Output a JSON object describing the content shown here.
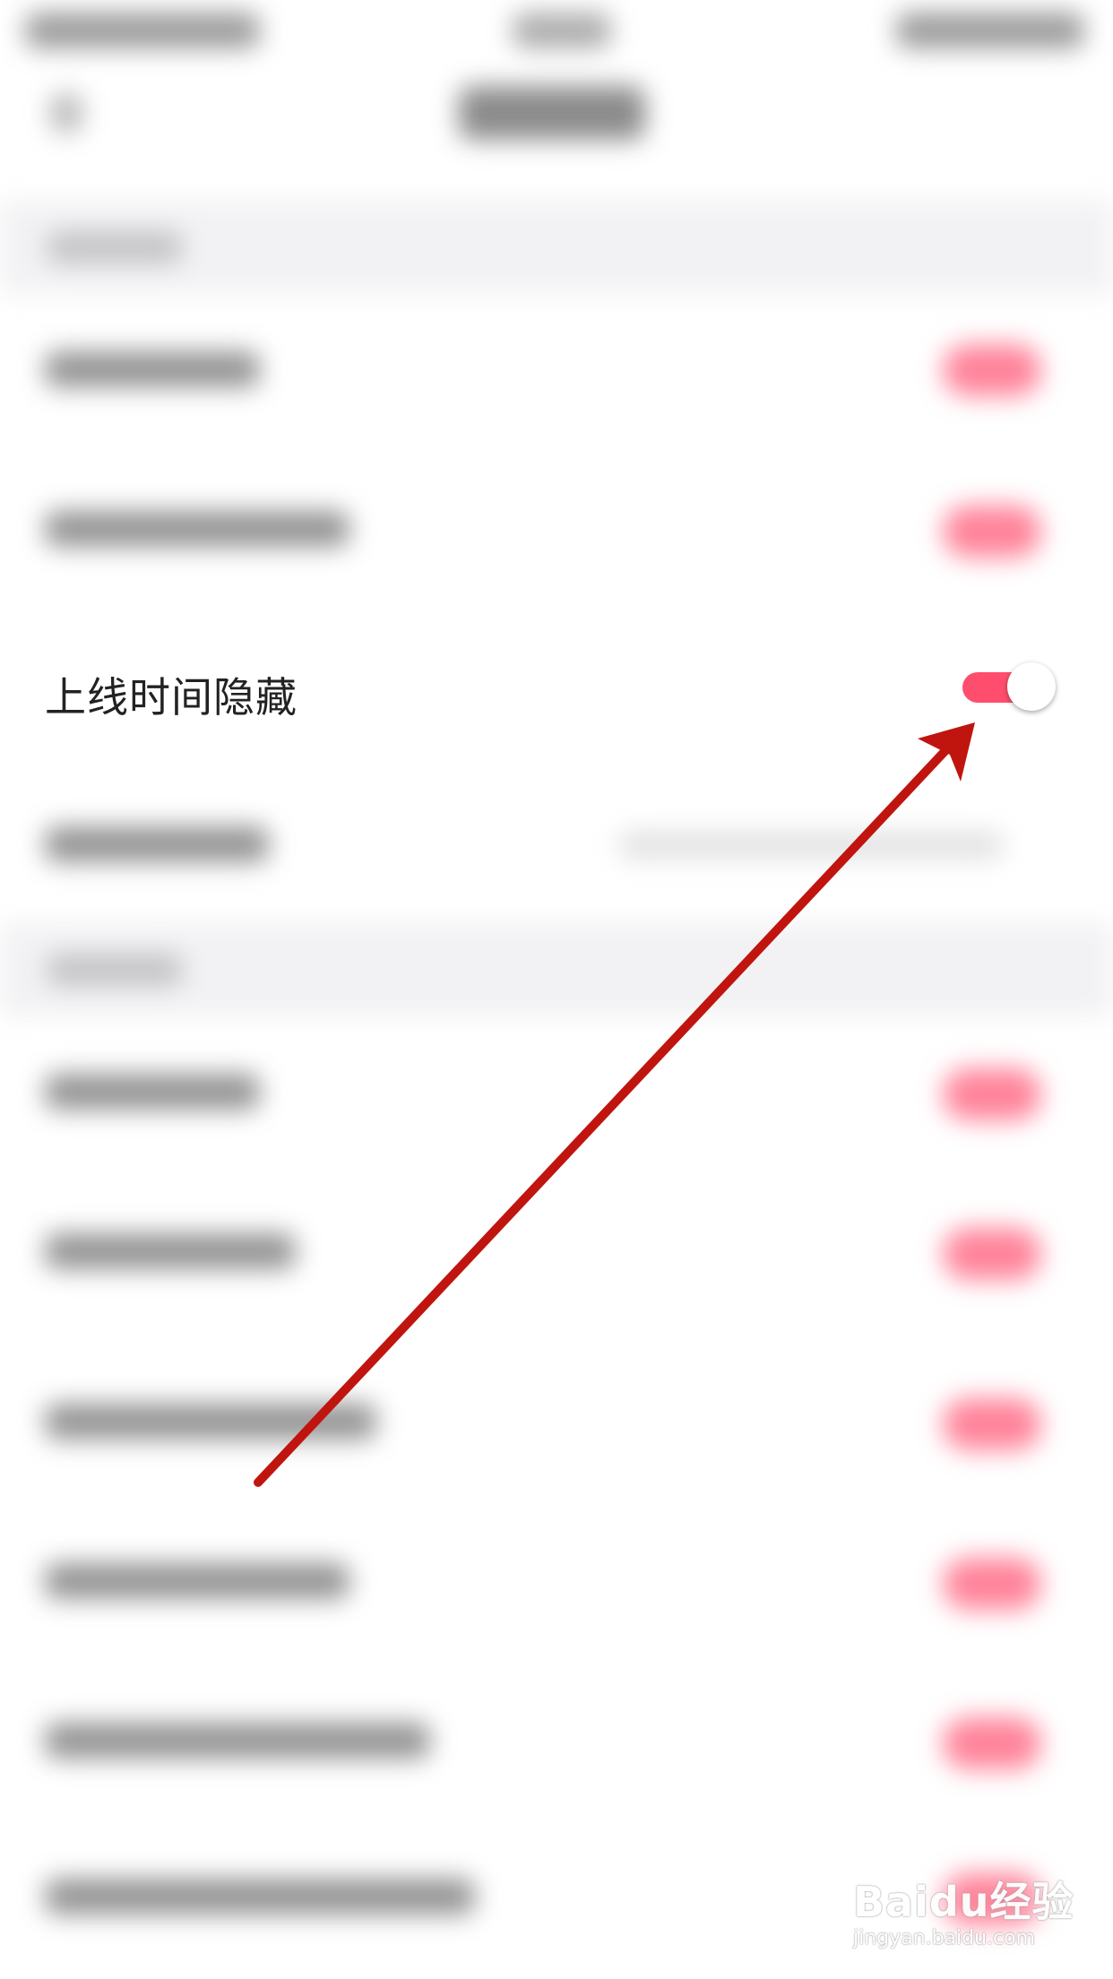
{
  "settings": {
    "hide_online_time": {
      "label": "上线时间隐藏",
      "enabled": true
    }
  },
  "colors": {
    "toggle_on": "#ff4d6d",
    "annotation_arrow": "#c0150f",
    "background": "#ffffff",
    "section_background": "#f2f2f4"
  },
  "watermark": {
    "brand": "Baidu经验",
    "url": "jingyan.baidu.com"
  }
}
